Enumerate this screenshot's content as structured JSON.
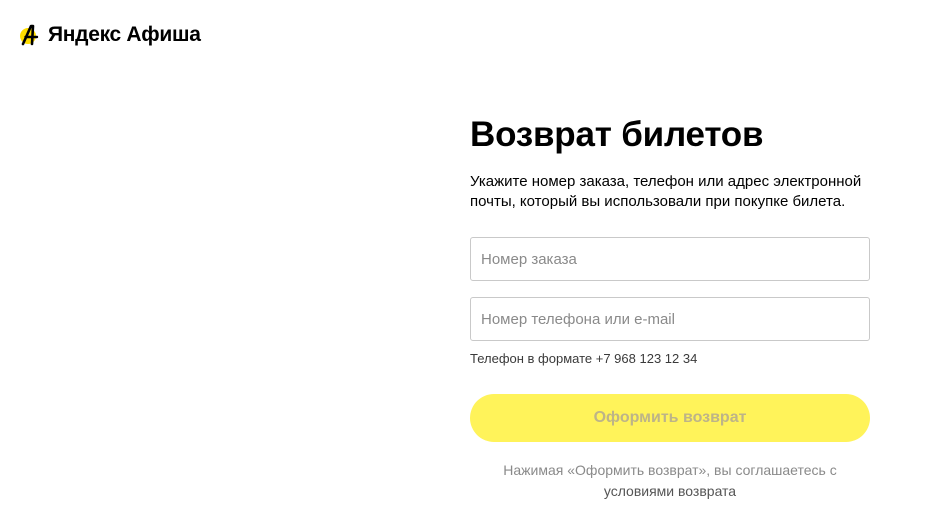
{
  "header": {
    "logo_text": "Яндекс Афиша",
    "logo_icon": "afisha-logo-icon"
  },
  "colors": {
    "accent_yellow": "#FFF35A",
    "logo_yellow": "#FFDD00",
    "placeholder_gray": "#8A8A8A",
    "disabled_button_text": "#BDB488"
  },
  "form": {
    "title": "Возврат билетов",
    "description": "Укажите номер заказа, телефон или адрес электронной почты, который вы использовали при покупке билета.",
    "order_field": {
      "value": "",
      "placeholder": "Номер заказа"
    },
    "contact_field": {
      "value": "",
      "placeholder": "Номер телефона или e-mail"
    },
    "phone_hint": "Телефон в формате +7 968 123 12 34",
    "submit_label": "Оформить возврат",
    "agreement_text": "Нажимая «Оформить возврат», вы соглашаетесь с",
    "agreement_link": "условиями возврата"
  }
}
